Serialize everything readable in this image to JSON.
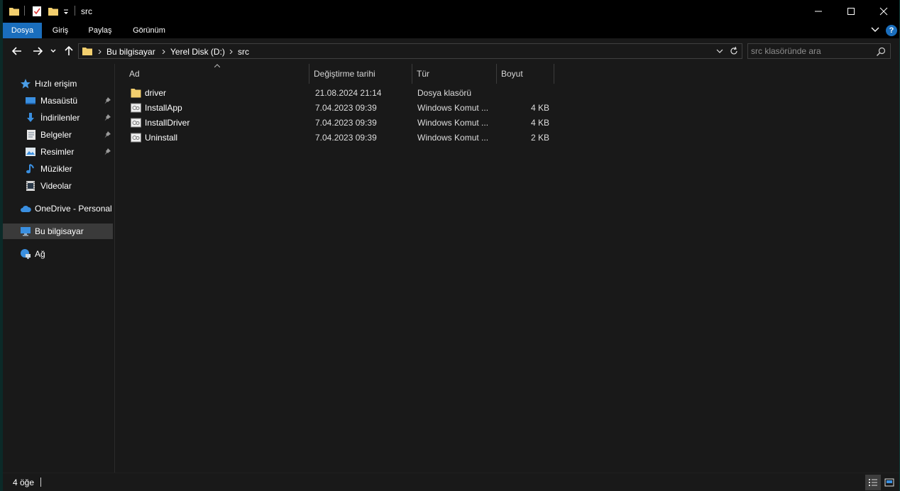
{
  "window": {
    "title": "src",
    "controls": {
      "minimize": "minimize-icon",
      "maximize": "maximize-icon",
      "close": "close-icon"
    }
  },
  "ribbon": {
    "tabs": [
      {
        "label": "Dosya",
        "active": true
      },
      {
        "label": "Giriş",
        "active": false
      },
      {
        "label": "Paylaş",
        "active": false
      },
      {
        "label": "Görünüm",
        "active": false
      }
    ],
    "help_label": "?"
  },
  "address": {
    "breadcrumbs": [
      "Bu bilgisayar",
      "Yerel Disk (D:)",
      "src"
    ]
  },
  "search": {
    "placeholder": "src klasöründe ara"
  },
  "sidebar": {
    "items": [
      {
        "label": "Hızlı erişim",
        "icon": "star-icon"
      },
      {
        "label": "Masaüstü",
        "icon": "desktop-icon",
        "pinned": true
      },
      {
        "label": "İndirilenler",
        "icon": "download-icon",
        "pinned": true
      },
      {
        "label": "Belgeler",
        "icon": "documents-icon",
        "pinned": true
      },
      {
        "label": "Resimler",
        "icon": "pictures-icon",
        "pinned": true
      },
      {
        "label": "Müzikler",
        "icon": "music-icon"
      },
      {
        "label": "Videolar",
        "icon": "videos-icon"
      },
      {
        "label": "OneDrive - Personal",
        "icon": "cloud-icon"
      },
      {
        "label": "Bu bilgisayar",
        "icon": "computer-icon",
        "selected": true
      },
      {
        "label": "Ağ",
        "icon": "network-icon"
      }
    ]
  },
  "columns": {
    "name": "Ad",
    "date": "Değiştirme tarihi",
    "type": "Tür",
    "size": "Boyut"
  },
  "files": [
    {
      "name": "driver",
      "date": "21.08.2024 21:14",
      "type": "Dosya klasörü",
      "size": "",
      "icon": "folder-icon"
    },
    {
      "name": "InstallApp",
      "date": "7.04.2023 09:39",
      "type": "Windows Komut ...",
      "size": "4 KB",
      "icon": "batch-file-icon"
    },
    {
      "name": "InstallDriver",
      "date": "7.04.2023 09:39",
      "type": "Windows Komut ...",
      "size": "4 KB",
      "icon": "batch-file-icon"
    },
    {
      "name": "Uninstall",
      "date": "7.04.2023 09:39",
      "type": "Windows Komut ...",
      "size": "2 KB",
      "icon": "batch-file-icon"
    }
  ],
  "status": {
    "count": "4 öğe"
  },
  "colors": {
    "accent": "#1a6ebd",
    "folder": "#f3cf6e",
    "background": "#191919"
  }
}
